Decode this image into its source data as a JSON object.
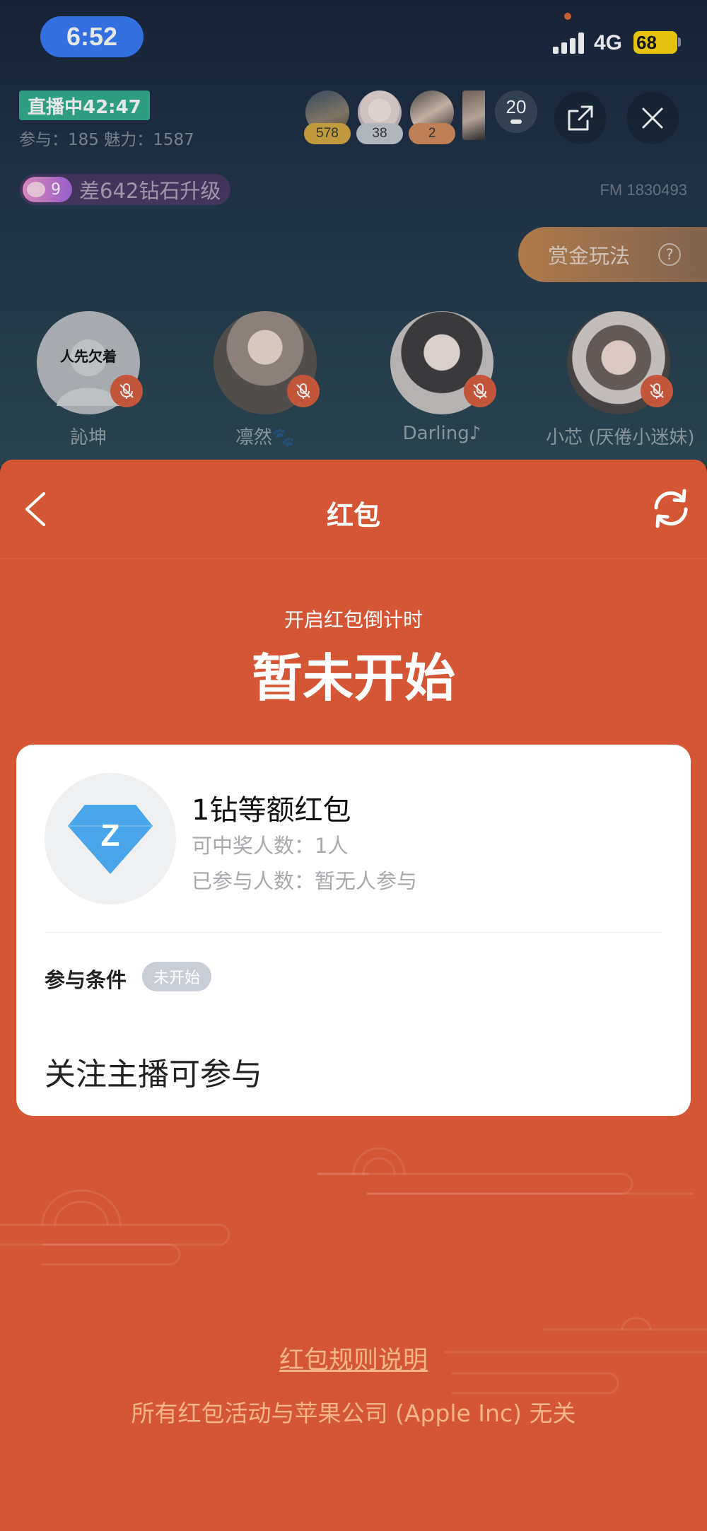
{
  "status_bar": {
    "time": "6:52",
    "network": "4G",
    "battery": "68"
  },
  "room": {
    "live_badge": "直播中42:47",
    "stats": "参与：185 魅力：1587",
    "viewers": [
      {
        "count": "578",
        "badge_color": "#d7a93f"
      },
      {
        "count": "38",
        "badge_color": "#c4c8cf"
      },
      {
        "count": "2",
        "badge_color": "#d38a5a"
      }
    ],
    "online_count": "20",
    "level_number": "9",
    "diamond_upgrade": "差642钻石升级",
    "fm_id": "FM 1830493",
    "bounty_label": "赏金玩法",
    "bounty_help": "?",
    "seats": [
      {
        "name": "訫坤",
        "placeholder": "人先欠着"
      },
      {
        "name": "凛然🐾",
        "placeholder": ""
      },
      {
        "name": "Darling♪",
        "placeholder": ""
      },
      {
        "name": "小芯 (厌倦小迷妹)",
        "placeholder": ""
      }
    ]
  },
  "panel": {
    "title": "红包",
    "countdown_label": "开启红包倒计时",
    "countdown_value": "暂未开始",
    "prize": {
      "icon_letter": "Z",
      "title": "1钻等额红包",
      "winners": "可中奖人数：1人",
      "participants": "已参与人数：暂无人参与"
    },
    "condition_label": "参与条件",
    "condition_status": "未开始",
    "condition_text": "关注主播可参与",
    "rules_link": "红包规则说明",
    "disclaimer": "所有红包活动与苹果公司 (Apple Inc) 无关"
  },
  "colors": {
    "panel_bg": "#d55634",
    "card_bg": "#ffffff",
    "accent_link": "#f5b48a",
    "live_badge": "#2fae8e",
    "time_pill": "#3478f6"
  }
}
